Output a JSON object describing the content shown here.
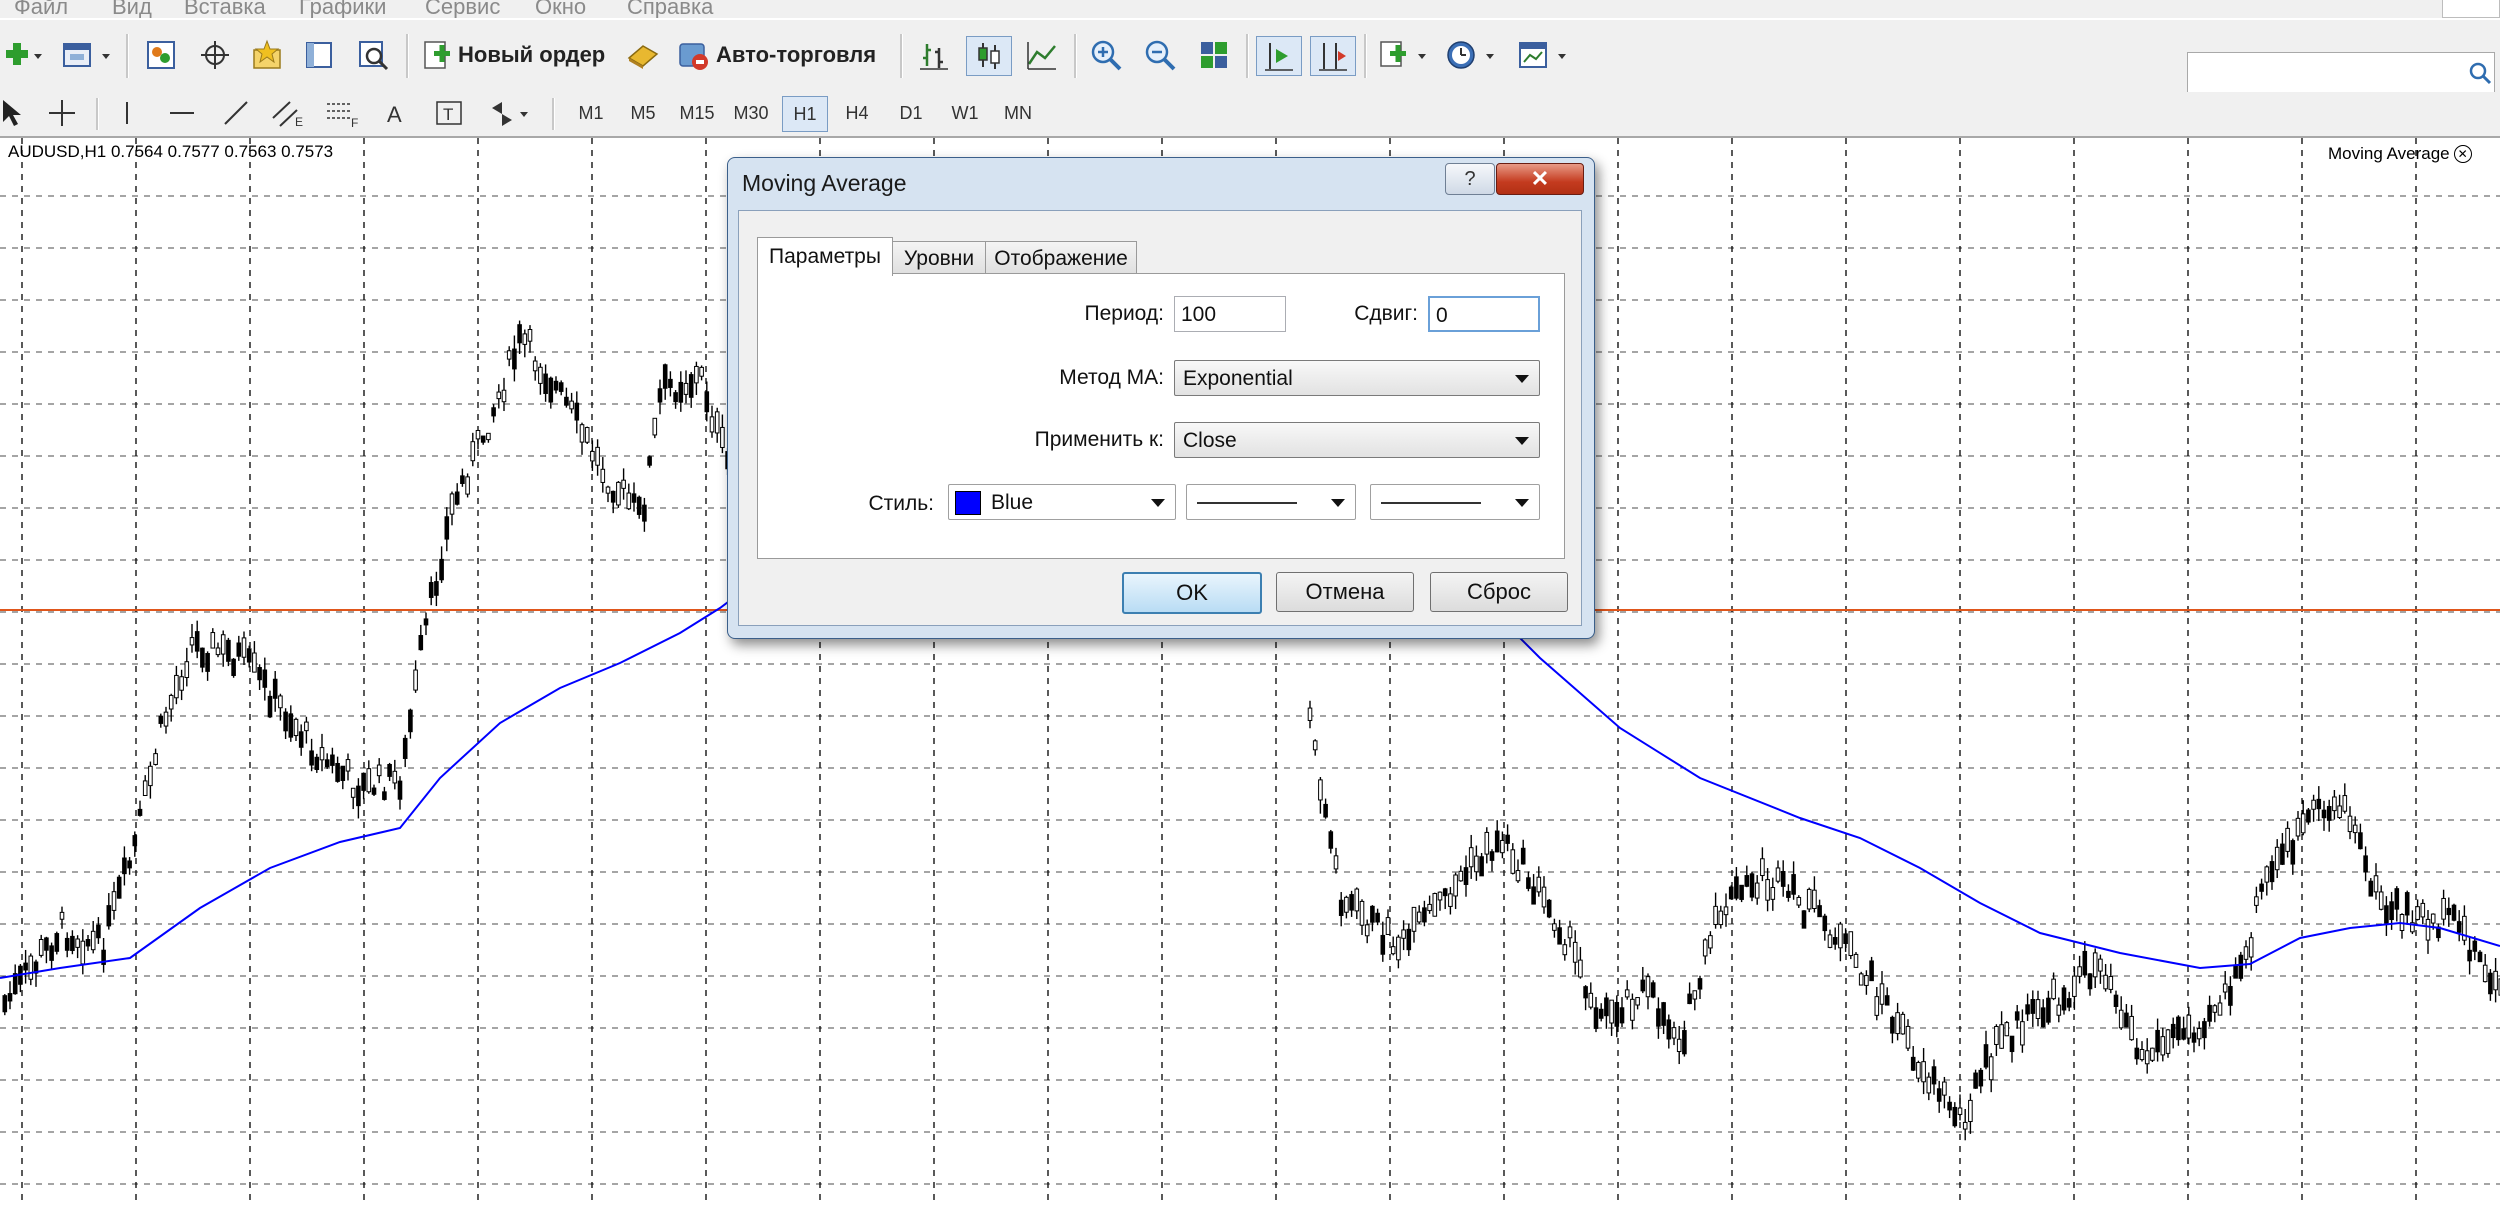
{
  "menubar": {
    "items": [
      "Файл",
      "Вид",
      "Вставка",
      "Графики",
      "Сервис",
      "Окно",
      "Справка"
    ]
  },
  "toolbar": {
    "new_order_label": "Новый ордер",
    "autotrading_label": "Авто-торговля",
    "timeframes": [
      "M1",
      "M5",
      "M15",
      "M30",
      "H1",
      "H4",
      "D1",
      "W1",
      "MN"
    ],
    "active_timeframe": "H1"
  },
  "chart": {
    "symbol_title": "AUDUSD,H1  0.7564 0.7577 0.7563 0.7573",
    "indicator_label": "Moving Average",
    "candle_color": "#000000",
    "ma_color": "#0000ff",
    "price_line_color": "#e0561b",
    "grid_style": "dashed"
  },
  "dialog": {
    "title": "Moving Average",
    "help_glyph": "?",
    "close_glyph": "✕",
    "tabs": [
      "Параметры",
      "Уровни",
      "Отображение"
    ],
    "selected_tab": "Параметры",
    "period_label": "Период:",
    "period_value": "100",
    "shift_label": "Сдвиг:",
    "shift_value": "0",
    "method_label": "Метод МА:",
    "method_value": "Exponential",
    "apply_label": "Применить к:",
    "apply_value": "Close",
    "style_label": "Стиль:",
    "style_color_name": "Blue",
    "style_color": "#0000ff",
    "ok_label": "OK",
    "cancel_label": "Отмена",
    "reset_label": "Сброс"
  }
}
